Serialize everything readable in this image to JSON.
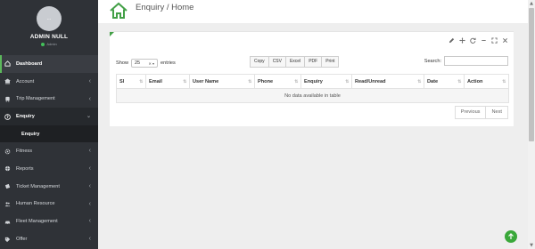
{
  "sidebar": {
    "avatar_text": "...",
    "user_name": "ADMIN NULL",
    "user_status": "Admin",
    "items": [
      {
        "label": "Dashboard",
        "icon": "home-icon",
        "has_chevron": false
      },
      {
        "label": "Account",
        "icon": "bank-icon",
        "has_chevron": true
      },
      {
        "label": "Trip Management",
        "icon": "bus-icon",
        "has_chevron": true
      },
      {
        "label": "Enquiry",
        "icon": "question-circle-icon",
        "has_chevron": true
      },
      {
        "label": "Fitness",
        "icon": "gear-icon",
        "has_chevron": true
      },
      {
        "label": "Reports",
        "icon": "globe-icon",
        "has_chevron": true
      },
      {
        "label": "Ticket Management",
        "icon": "ticket-icon",
        "has_chevron": true
      },
      {
        "label": "Human Resource",
        "icon": "users-icon",
        "has_chevron": true
      },
      {
        "label": "Fleet Management",
        "icon": "car-icon",
        "has_chevron": true
      },
      {
        "label": "Offer",
        "icon": "tag-icon",
        "has_chevron": true
      }
    ],
    "open_sub_item": "Enquiry"
  },
  "header": {
    "title": "Enquiry / Home",
    "icon": "home-outline-icon"
  },
  "panel": {
    "tools": [
      "pencil-icon",
      "move-icon",
      "refresh-icon",
      "minimize-icon",
      "expand-icon",
      "close-icon"
    ],
    "show_label": "Show",
    "entries_value": "25",
    "entries_label": "entries",
    "export_buttons": [
      "Copy",
      "CSV",
      "Excel",
      "PDF",
      "Print"
    ],
    "search_label": "Search:",
    "search_value": "",
    "columns": [
      "Sl",
      "Email",
      "User Name",
      "Phone",
      "Enquiry",
      "Read/Unread",
      "Date",
      "Action"
    ],
    "empty_message": "No data available in table",
    "pagination": {
      "previous": "Previous",
      "next": "Next"
    }
  },
  "colors": {
    "sidebar_bg": "#2f3237",
    "accent_green": "#43a047",
    "scroll_to_top": "#3aa83a"
  }
}
